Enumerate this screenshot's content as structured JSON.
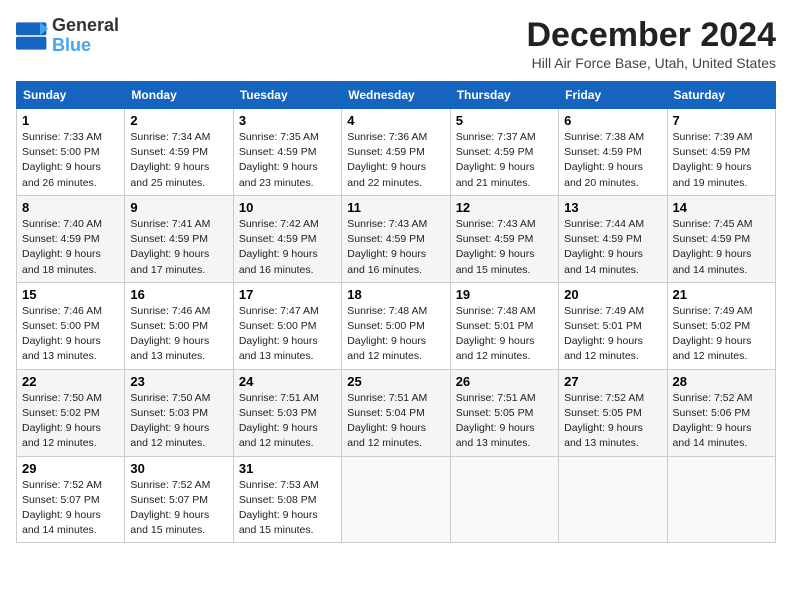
{
  "header": {
    "logo_line1": "General",
    "logo_line2": "Blue",
    "month": "December 2024",
    "location": "Hill Air Force Base, Utah, United States"
  },
  "weekdays": [
    "Sunday",
    "Monday",
    "Tuesday",
    "Wednesday",
    "Thursday",
    "Friday",
    "Saturday"
  ],
  "weeks": [
    [
      {
        "day": "1",
        "sunrise": "Sunrise: 7:33 AM",
        "sunset": "Sunset: 5:00 PM",
        "daylight": "Daylight: 9 hours and 26 minutes."
      },
      {
        "day": "2",
        "sunrise": "Sunrise: 7:34 AM",
        "sunset": "Sunset: 4:59 PM",
        "daylight": "Daylight: 9 hours and 25 minutes."
      },
      {
        "day": "3",
        "sunrise": "Sunrise: 7:35 AM",
        "sunset": "Sunset: 4:59 PM",
        "daylight": "Daylight: 9 hours and 23 minutes."
      },
      {
        "day": "4",
        "sunrise": "Sunrise: 7:36 AM",
        "sunset": "Sunset: 4:59 PM",
        "daylight": "Daylight: 9 hours and 22 minutes."
      },
      {
        "day": "5",
        "sunrise": "Sunrise: 7:37 AM",
        "sunset": "Sunset: 4:59 PM",
        "daylight": "Daylight: 9 hours and 21 minutes."
      },
      {
        "day": "6",
        "sunrise": "Sunrise: 7:38 AM",
        "sunset": "Sunset: 4:59 PM",
        "daylight": "Daylight: 9 hours and 20 minutes."
      },
      {
        "day": "7",
        "sunrise": "Sunrise: 7:39 AM",
        "sunset": "Sunset: 4:59 PM",
        "daylight": "Daylight: 9 hours and 19 minutes."
      }
    ],
    [
      {
        "day": "8",
        "sunrise": "Sunrise: 7:40 AM",
        "sunset": "Sunset: 4:59 PM",
        "daylight": "Daylight: 9 hours and 18 minutes."
      },
      {
        "day": "9",
        "sunrise": "Sunrise: 7:41 AM",
        "sunset": "Sunset: 4:59 PM",
        "daylight": "Daylight: 9 hours and 17 minutes."
      },
      {
        "day": "10",
        "sunrise": "Sunrise: 7:42 AM",
        "sunset": "Sunset: 4:59 PM",
        "daylight": "Daylight: 9 hours and 16 minutes."
      },
      {
        "day": "11",
        "sunrise": "Sunrise: 7:43 AM",
        "sunset": "Sunset: 4:59 PM",
        "daylight": "Daylight: 9 hours and 16 minutes."
      },
      {
        "day": "12",
        "sunrise": "Sunrise: 7:43 AM",
        "sunset": "Sunset: 4:59 PM",
        "daylight": "Daylight: 9 hours and 15 minutes."
      },
      {
        "day": "13",
        "sunrise": "Sunrise: 7:44 AM",
        "sunset": "Sunset: 4:59 PM",
        "daylight": "Daylight: 9 hours and 14 minutes."
      },
      {
        "day": "14",
        "sunrise": "Sunrise: 7:45 AM",
        "sunset": "Sunset: 4:59 PM",
        "daylight": "Daylight: 9 hours and 14 minutes."
      }
    ],
    [
      {
        "day": "15",
        "sunrise": "Sunrise: 7:46 AM",
        "sunset": "Sunset: 5:00 PM",
        "daylight": "Daylight: 9 hours and 13 minutes."
      },
      {
        "day": "16",
        "sunrise": "Sunrise: 7:46 AM",
        "sunset": "Sunset: 5:00 PM",
        "daylight": "Daylight: 9 hours and 13 minutes."
      },
      {
        "day": "17",
        "sunrise": "Sunrise: 7:47 AM",
        "sunset": "Sunset: 5:00 PM",
        "daylight": "Daylight: 9 hours and 13 minutes."
      },
      {
        "day": "18",
        "sunrise": "Sunrise: 7:48 AM",
        "sunset": "Sunset: 5:00 PM",
        "daylight": "Daylight: 9 hours and 12 minutes."
      },
      {
        "day": "19",
        "sunrise": "Sunrise: 7:48 AM",
        "sunset": "Sunset: 5:01 PM",
        "daylight": "Daylight: 9 hours and 12 minutes."
      },
      {
        "day": "20",
        "sunrise": "Sunrise: 7:49 AM",
        "sunset": "Sunset: 5:01 PM",
        "daylight": "Daylight: 9 hours and 12 minutes."
      },
      {
        "day": "21",
        "sunrise": "Sunrise: 7:49 AM",
        "sunset": "Sunset: 5:02 PM",
        "daylight": "Daylight: 9 hours and 12 minutes."
      }
    ],
    [
      {
        "day": "22",
        "sunrise": "Sunrise: 7:50 AM",
        "sunset": "Sunset: 5:02 PM",
        "daylight": "Daylight: 9 hours and 12 minutes."
      },
      {
        "day": "23",
        "sunrise": "Sunrise: 7:50 AM",
        "sunset": "Sunset: 5:03 PM",
        "daylight": "Daylight: 9 hours and 12 minutes."
      },
      {
        "day": "24",
        "sunrise": "Sunrise: 7:51 AM",
        "sunset": "Sunset: 5:03 PM",
        "daylight": "Daylight: 9 hours and 12 minutes."
      },
      {
        "day": "25",
        "sunrise": "Sunrise: 7:51 AM",
        "sunset": "Sunset: 5:04 PM",
        "daylight": "Daylight: 9 hours and 12 minutes."
      },
      {
        "day": "26",
        "sunrise": "Sunrise: 7:51 AM",
        "sunset": "Sunset: 5:05 PM",
        "daylight": "Daylight: 9 hours and 13 minutes."
      },
      {
        "day": "27",
        "sunrise": "Sunrise: 7:52 AM",
        "sunset": "Sunset: 5:05 PM",
        "daylight": "Daylight: 9 hours and 13 minutes."
      },
      {
        "day": "28",
        "sunrise": "Sunrise: 7:52 AM",
        "sunset": "Sunset: 5:06 PM",
        "daylight": "Daylight: 9 hours and 14 minutes."
      }
    ],
    [
      {
        "day": "29",
        "sunrise": "Sunrise: 7:52 AM",
        "sunset": "Sunset: 5:07 PM",
        "daylight": "Daylight: 9 hours and 14 minutes."
      },
      {
        "day": "30",
        "sunrise": "Sunrise: 7:52 AM",
        "sunset": "Sunset: 5:07 PM",
        "daylight": "Daylight: 9 hours and 15 minutes."
      },
      {
        "day": "31",
        "sunrise": "Sunrise: 7:53 AM",
        "sunset": "Sunset: 5:08 PM",
        "daylight": "Daylight: 9 hours and 15 minutes."
      },
      null,
      null,
      null,
      null
    ]
  ]
}
